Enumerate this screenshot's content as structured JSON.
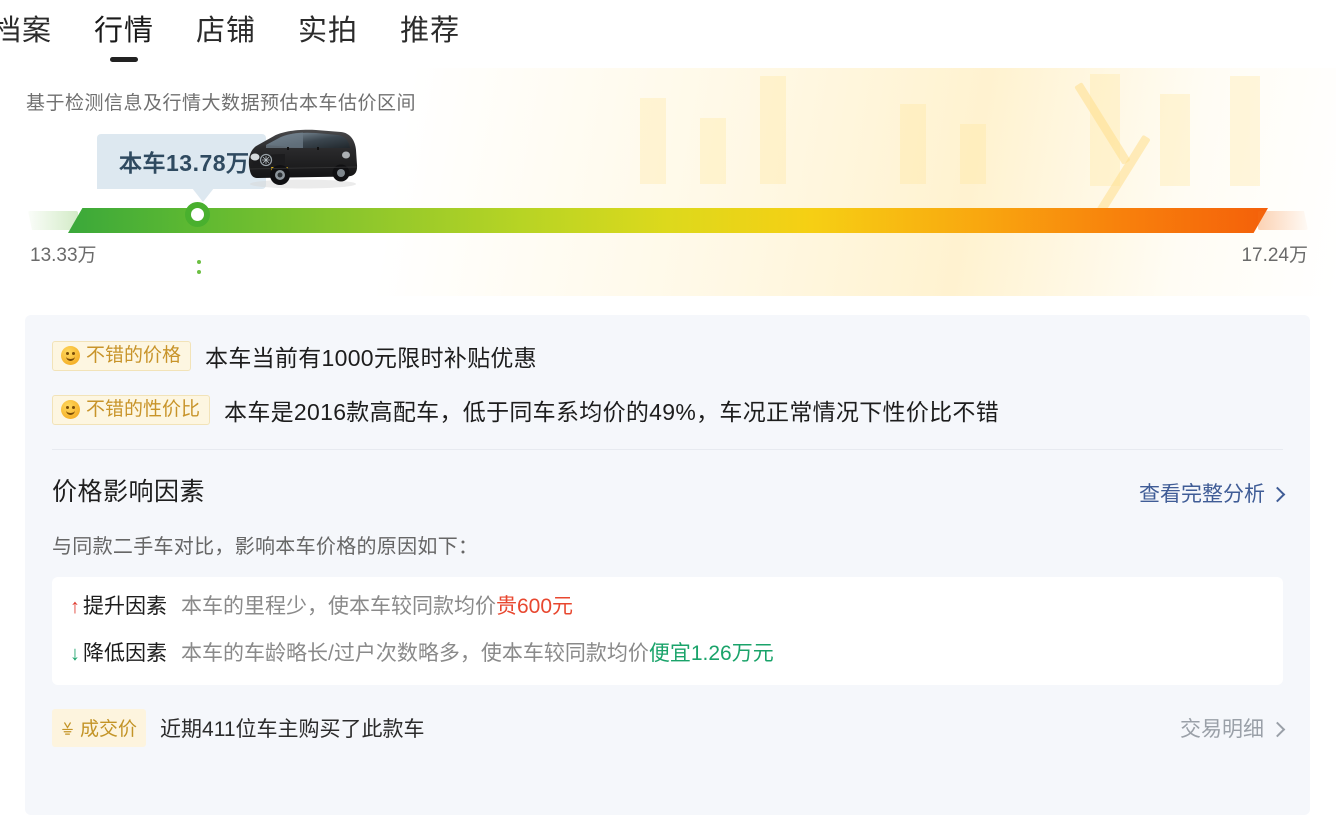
{
  "tabs": [
    {
      "label": "档案",
      "active": false
    },
    {
      "label": "行情",
      "active": true
    },
    {
      "label": "店铺",
      "active": false
    },
    {
      "label": "实拍",
      "active": false
    },
    {
      "label": "推荐",
      "active": false
    }
  ],
  "hero": {
    "subtitle": "基于检测信息及行情大数据预估本车估价区间",
    "callout": "本车13.78万",
    "range_min": "13.33万",
    "range_max": "17.24万",
    "car_image_alt": "black-mpv-van",
    "marker_color": "#49b02e",
    "gradient_start": "#3aa83a",
    "gradient_end": "#f4600a"
  },
  "card": {
    "highlights": [
      {
        "badge": "不错的价格",
        "icon": "smiley-icon",
        "caption": "本车当前有1000元限时补贴优惠"
      },
      {
        "badge": "不错的性价比",
        "icon": "smiley-icon",
        "caption": "本车是2016款高配车，低于同车系均价的49%，车况正常情况下性价比不错"
      }
    ],
    "section": {
      "title": "价格影响因素",
      "link": "查看完整分析",
      "link_icon": "chevron-right-icon",
      "desc": "与同款二手车对比，影响本车价格的原因如下："
    },
    "factors": [
      {
        "arrow": "↑",
        "arrow_dir": "up",
        "label": "提升因素",
        "text_before": "本车的里程少，使本车较同款均价",
        "value": "贵600元",
        "value_color": "#e8472f"
      },
      {
        "arrow": "↓",
        "arrow_dir": "down",
        "label": "降低因素",
        "text_before": "本车的车龄略长/过户次数略多，使本车较同款均价",
        "value": "便宜1.26万元",
        "value_color": "#1aa36a"
      }
    ],
    "deal": {
      "badge": "成交价",
      "badge_icon": "hand-tap-icon",
      "caption": "近期411位车主购买了此款车",
      "link": "交易明细",
      "link_icon": "chevron-right-icon"
    }
  }
}
